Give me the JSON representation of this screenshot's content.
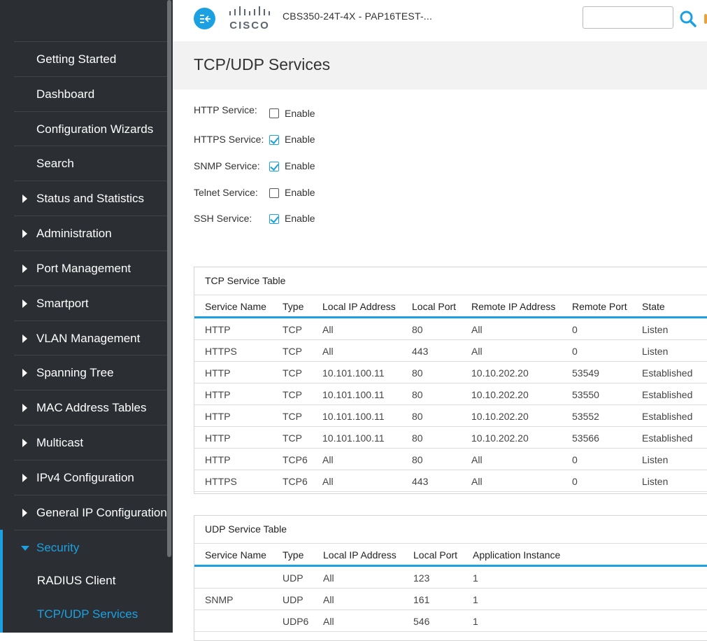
{
  "header": {
    "brand": "CISCO",
    "device_name": "CBS350-24T-4X - PAP16TEST-...",
    "search_placeholder": ""
  },
  "sidebar": {
    "items": [
      {
        "label": "Getting Started",
        "expandable": false
      },
      {
        "label": "Dashboard",
        "expandable": false
      },
      {
        "label": "Configuration Wizards",
        "expandable": false
      },
      {
        "label": "Search",
        "expandable": false
      },
      {
        "label": "Status and Statistics",
        "expandable": true
      },
      {
        "label": "Administration",
        "expandable": true
      },
      {
        "label": "Port Management",
        "expandable": true
      },
      {
        "label": "Smartport",
        "expandable": true
      },
      {
        "label": "VLAN Management",
        "expandable": true
      },
      {
        "label": "Spanning Tree",
        "expandable": true
      },
      {
        "label": "MAC Address Tables",
        "expandable": true
      },
      {
        "label": "Multicast",
        "expandable": true
      },
      {
        "label": "IPv4 Configuration",
        "expandable": true
      },
      {
        "label": "General IP Configuration",
        "expandable": true
      },
      {
        "label": "Security",
        "expandable": true,
        "expanded": true
      }
    ],
    "sub_items": [
      {
        "label": "RADIUS Client"
      },
      {
        "label": "TCP/UDP Services",
        "current": true
      }
    ]
  },
  "page": {
    "title": "TCP/UDP Services"
  },
  "services": [
    {
      "label": "HTTP Service:",
      "option": "Enable",
      "checked": false
    },
    {
      "label": "HTTPS Service:",
      "option": "Enable",
      "checked": true
    },
    {
      "label": "SNMP Service:",
      "option": "Enable",
      "checked": true
    },
    {
      "label": "Telnet Service:",
      "option": "Enable",
      "checked": false
    },
    {
      "label": "SSH Service:",
      "option": "Enable",
      "checked": true
    }
  ],
  "tcp_table": {
    "caption": "TCP Service Table",
    "columns": [
      "Service Name",
      "Type",
      "Local IP Address",
      "Local Port",
      "Remote IP Address",
      "Remote Port",
      "State"
    ],
    "rows": [
      [
        "HTTP",
        "TCP",
        "All",
        "80",
        "All",
        "0",
        "Listen"
      ],
      [
        "HTTPS",
        "TCP",
        "All",
        "443",
        "All",
        "0",
        "Listen"
      ],
      [
        "HTTP",
        "TCP",
        "10.101.100.11",
        "80",
        "10.10.202.20",
        "53549",
        "Established"
      ],
      [
        "HTTP",
        "TCP",
        "10.101.100.11",
        "80",
        "10.10.202.20",
        "53550",
        "Established"
      ],
      [
        "HTTP",
        "TCP",
        "10.101.100.11",
        "80",
        "10.10.202.20",
        "53552",
        "Established"
      ],
      [
        "HTTP",
        "TCP",
        "10.101.100.11",
        "80",
        "10.10.202.20",
        "53566",
        "Established"
      ],
      [
        "HTTP",
        "TCP6",
        "All",
        "80",
        "All",
        "0",
        "Listen"
      ],
      [
        "HTTPS",
        "TCP6",
        "All",
        "443",
        "All",
        "0",
        "Listen"
      ]
    ]
  },
  "udp_table": {
    "caption": "UDP Service Table",
    "columns": [
      "Service Name",
      "Type",
      "Local IP Address",
      "Local Port",
      "Application Instance"
    ],
    "rows": [
      [
        "",
        "UDP",
        "All",
        "123",
        "1"
      ],
      [
        "SNMP",
        "UDP",
        "All",
        "161",
        "1"
      ],
      [
        "",
        "UDP6",
        "All",
        "546",
        "1"
      ]
    ]
  },
  "colors": {
    "accent": "#1ba1e2",
    "sidebar_bg": "#2b2e33"
  }
}
